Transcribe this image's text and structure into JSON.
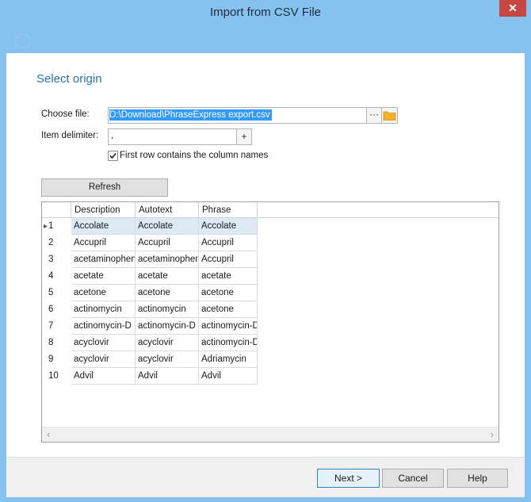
{
  "window": {
    "title": "Import from CSV File",
    "close_glyph": "✕"
  },
  "page": {
    "heading": "Select origin"
  },
  "form": {
    "choose_file_label": "Choose file:",
    "file_value": "D:\\Download\\PhraseExpress export.csv",
    "browse_glyph": "···",
    "item_delimiter_label": "Item delimiter:",
    "delimiter_value": ",",
    "add_glyph": "+",
    "first_row_checked": true,
    "first_row_label": "First row contains the column names",
    "refresh_label": "Refresh"
  },
  "table": {
    "columns": [
      "Description",
      "Autotext",
      "Phrase"
    ],
    "rows": [
      {
        "n": "1",
        "cells": [
          "Accolate",
          "Accolate",
          "Accolate"
        ]
      },
      {
        "n": "2",
        "cells": [
          "Accupril",
          "Accupril",
          "Accupril"
        ]
      },
      {
        "n": "3",
        "cells": [
          "acetaminophen",
          "acetaminophen",
          "Accupril"
        ]
      },
      {
        "n": "4",
        "cells": [
          "acetate",
          "acetate",
          "acetate"
        ]
      },
      {
        "n": "5",
        "cells": [
          "acetone",
          "acetone",
          "acetone"
        ]
      },
      {
        "n": "6",
        "cells": [
          "actinomycin",
          "actinomycin",
          "acetone"
        ]
      },
      {
        "n": "7",
        "cells": [
          "actinomycin-D",
          "actinomycin-D",
          "actinomycin-D"
        ]
      },
      {
        "n": "8",
        "cells": [
          "acyclovir",
          "acyclovir",
          "actinomycin-D"
        ]
      },
      {
        "n": "9",
        "cells": [
          "acyclovir",
          "acyclovir",
          "Adriamycin"
        ]
      },
      {
        "n": "10",
        "cells": [
          "Advil",
          "Advil",
          "Advil"
        ]
      }
    ],
    "current_row_glyph": "▸",
    "scroll_left_glyph": "‹",
    "scroll_right_glyph": "›"
  },
  "footer": {
    "next_label": "Next >",
    "cancel_label": "Cancel",
    "help_label": "Help"
  },
  "colors": {
    "accent": "#2a70b0",
    "selection": "#3399ff",
    "titlebar": "#86c2f0",
    "close": "#c7463f"
  },
  "icons": [
    "close-icon",
    "folder-icon",
    "checkmark-icon",
    "row-indicator-icon"
  ]
}
